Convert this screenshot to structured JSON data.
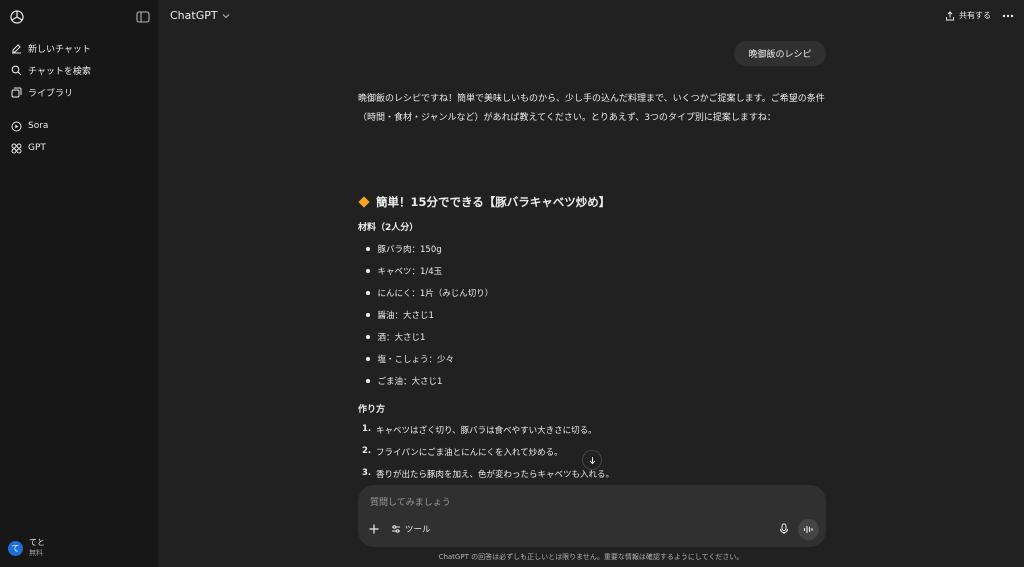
{
  "sidebar": {
    "items": [
      {
        "label": "新しいチャット",
        "icon": "edit-icon"
      },
      {
        "label": "チャットを検索",
        "icon": "search-icon"
      },
      {
        "label": "ライブラリ",
        "icon": "library-icon"
      },
      {
        "label": "Sora",
        "icon": "play-circle-icon"
      },
      {
        "label": "GPT",
        "icon": "grid-icon"
      }
    ],
    "user": {
      "initial": "て",
      "name": "てと",
      "plan": "無料"
    }
  },
  "header": {
    "model": "ChatGPT",
    "share_label": "共有する"
  },
  "chat": {
    "user_message": "晩御飯のレシピ",
    "intro": "晩御飯のレシピですね！簡単で美味しいものから、少し手の込んだ料理まで、いくつかご提案します。ご希望の条件（時間・食材・ジャンルなど）があれば教えてください。とりあえず、3つのタイプ別に提案しますね：",
    "recipe_title": "簡単！15分でできる【豚バラキャベツ炒め】",
    "ingredients_heading": "材料（2人分）",
    "ingredients": [
      "豚バラ肉：150g",
      "キャベツ：1/4玉",
      "にんにく：1片（みじん切り）",
      "醤油：大さじ1",
      "酒：大さじ1",
      "塩・こしょう：少々",
      "ごま油：大さじ1"
    ],
    "steps_heading": "作り方",
    "steps": [
      {
        "num": "1.",
        "text": "キャベツはざく切り、豚バラは食べやすい大きさに切る。"
      },
      {
        "num": "2.",
        "text": "フライパンにごま油とにんにくを入れて炒める。"
      },
      {
        "num": "3.",
        "text": "香りが出たら豚肉を加え、色が変わったらキャベツも入れる。"
      }
    ]
  },
  "composer": {
    "placeholder": "質問してみましょう",
    "tools_label": "ツール"
  },
  "disclaimer": "ChatGPT の回答は必ずしも正しいとは限りません。重要な情報は確認するようにしてください。",
  "colors": {
    "background": "#212121",
    "sidebar": "#171717",
    "accent": "#f5a524",
    "avatar": "#1e6fd9"
  }
}
